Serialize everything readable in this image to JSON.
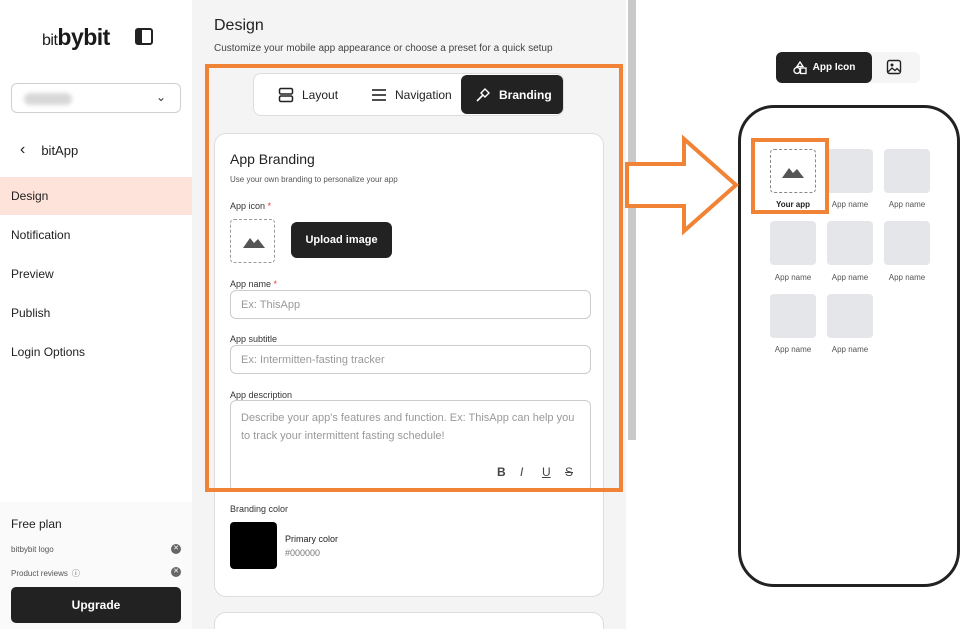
{
  "sidebar": {
    "logo_small": "bit",
    "logo_big": "bybit",
    "back_label": "bitApp",
    "items": [
      {
        "label": "Design",
        "active": true
      },
      {
        "label": "Notification",
        "active": false
      },
      {
        "label": "Preview",
        "active": false
      },
      {
        "label": "Publish",
        "active": false
      },
      {
        "label": "Login Options",
        "active": false
      }
    ],
    "plan": {
      "title": "Free plan",
      "row1": "bitbybit logo",
      "row2": "Product reviews",
      "upgrade_label": "Upgrade"
    }
  },
  "main": {
    "title": "Design",
    "subtitle": "Customize your mobile app appearance or choose a preset for a quick setup",
    "tabs": [
      {
        "label": "Layout",
        "icon": "layout-icon"
      },
      {
        "label": "Navigation",
        "icon": "menu-icon"
      },
      {
        "label": "Branding",
        "icon": "hammer-icon",
        "active": true
      }
    ],
    "branding": {
      "title": "App Branding",
      "subtitle": "Use your own branding to personalize your app",
      "icon_label": "App icon",
      "upload_label": "Upload image",
      "name_label": "App name",
      "name_placeholder": "Ex: ThisApp",
      "subtitle_label": "App subtitle",
      "subtitle_placeholder": "Ex: Intermitten-fasting tracker",
      "description_label": "App description",
      "description_placeholder": "Describe your app's features and function. Ex: ThisApp can help you to track your intermittent fasting schedule!",
      "color_label": "Branding color",
      "primary_label": "Primary color",
      "primary_hex": "#000000"
    }
  },
  "preview": {
    "seg_active_label": "App Icon",
    "your_app_label": "Your app",
    "app_name_label": "App name"
  },
  "colors": {
    "highlight": "#f08336",
    "active_nav": "#fde3d9",
    "dark": "#222222"
  }
}
